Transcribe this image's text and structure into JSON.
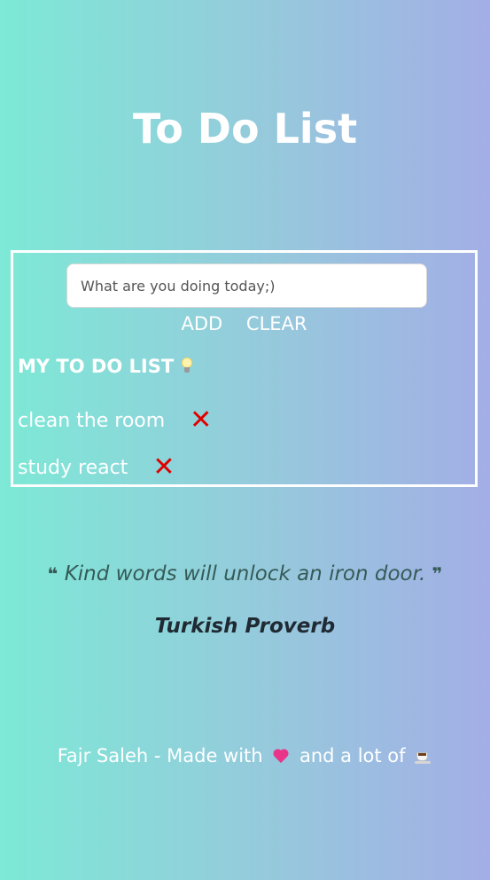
{
  "app": {
    "title": "To Do List"
  },
  "todo_panel": {
    "input_placeholder": "What are you doing today;)",
    "input_value": "",
    "add_label": "ADD",
    "clear_label": "CLEAR",
    "list_heading": "MY TO DO LIST",
    "heading_icon": "lightbulb-icon",
    "delete_icon_glyph": "✕",
    "items": [
      {
        "text": "clean the room"
      },
      {
        "text": "study react"
      }
    ]
  },
  "quote": {
    "open_mark": "❝",
    "text": "Kind words will unlock an iron door.",
    "close_mark": "❞",
    "author": "Turkish Proverb"
  },
  "footer": {
    "prefix": "Fajr Saleh - Made with",
    "middle": "and a lot of",
    "heart_icon": "heart-icon",
    "coffee_icon": "coffee-icon"
  },
  "colors": {
    "gradient_start": "#7de9d6",
    "gradient_end": "#a3aee6",
    "delete": "#e00000",
    "quote_text": "#355b57",
    "author_text": "#1f2a33"
  }
}
